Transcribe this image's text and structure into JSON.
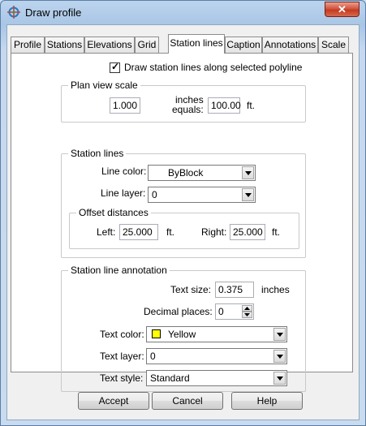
{
  "window": {
    "title": "Draw profile",
    "close_label": "✕"
  },
  "tabs": [
    {
      "label": "Profile",
      "active": false
    },
    {
      "label": "Stations",
      "active": false
    },
    {
      "label": "Elevations",
      "active": false
    },
    {
      "label": "Grid",
      "active": false
    },
    {
      "label": "Station lines",
      "active": true
    },
    {
      "label": "Caption",
      "active": false
    },
    {
      "label": "Annotations",
      "active": false
    },
    {
      "label": "Scale",
      "active": false
    }
  ],
  "draw_checkbox": {
    "label": "Draw station lines along selected polyline",
    "checked": true,
    "mark": "✓"
  },
  "plan_view_scale": {
    "title": "Plan view scale",
    "inches_value": "1.000",
    "inches_label_1": "inches",
    "inches_label_2": "equals:",
    "feet_value": "100.00",
    "feet_unit": "ft."
  },
  "station_lines": {
    "title": "Station lines",
    "line_color_label": "Line color:",
    "line_color_value": "ByBlock",
    "line_layer_label": "Line layer:",
    "line_layer_value": "0",
    "offset": {
      "title": "Offset distances",
      "left_label": "Left:",
      "left_value": "25.000",
      "left_unit": "ft.",
      "right_label": "Right:",
      "right_value": "25.000",
      "right_unit": "ft."
    }
  },
  "annotation": {
    "title": "Station line annotation",
    "text_size_label": "Text size:",
    "text_size_value": "0.375",
    "text_size_unit": "inches",
    "decimal_label": "Decimal places:",
    "decimal_value": "0",
    "text_color_label": "Text color:",
    "text_color_value": "Yellow",
    "text_color_swatch": "#ffff00",
    "text_layer_label": "Text layer:",
    "text_layer_value": "0",
    "text_style_label": "Text style:",
    "text_style_value": "Standard"
  },
  "buttons": {
    "accept": "Accept",
    "cancel": "Cancel",
    "help": "Help"
  }
}
